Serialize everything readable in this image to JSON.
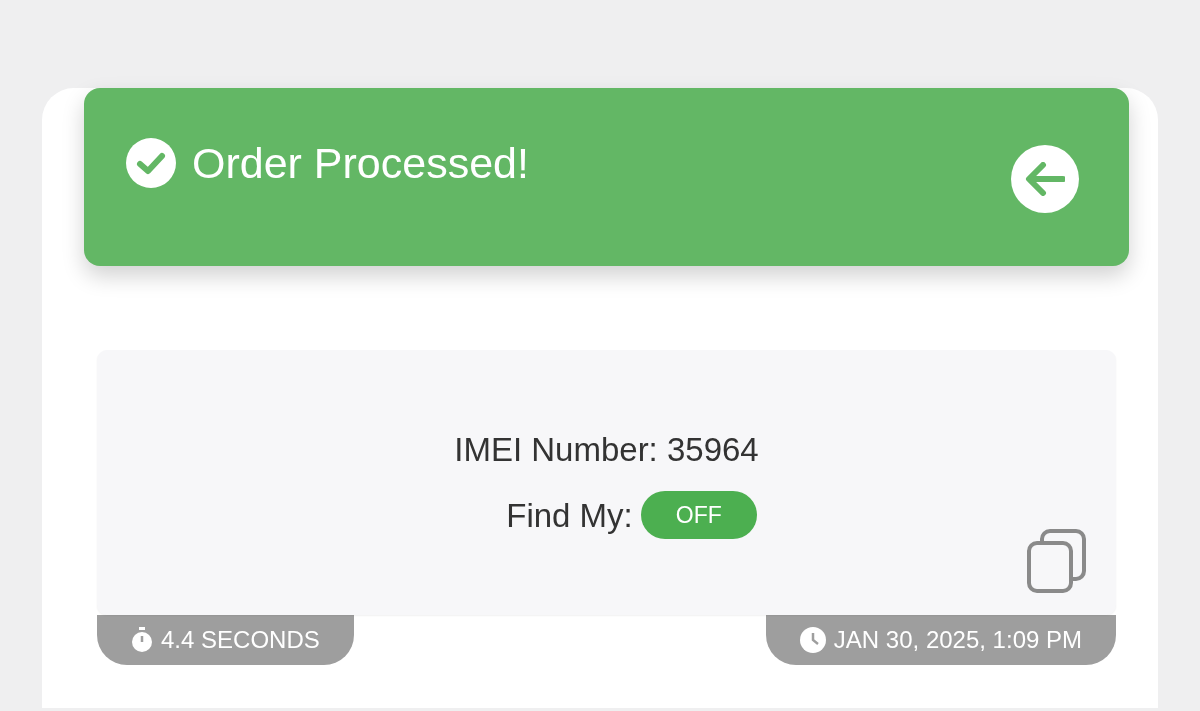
{
  "header": {
    "title": "Order Processed!"
  },
  "details": {
    "imei_label": "IMEI Number:",
    "imei_value": "35964",
    "find_my_label": "Find My:",
    "find_my_value": "OFF"
  },
  "footer": {
    "duration": "4.4 SECONDS",
    "timestamp": "JAN 30, 2025, 1:09 PM"
  }
}
